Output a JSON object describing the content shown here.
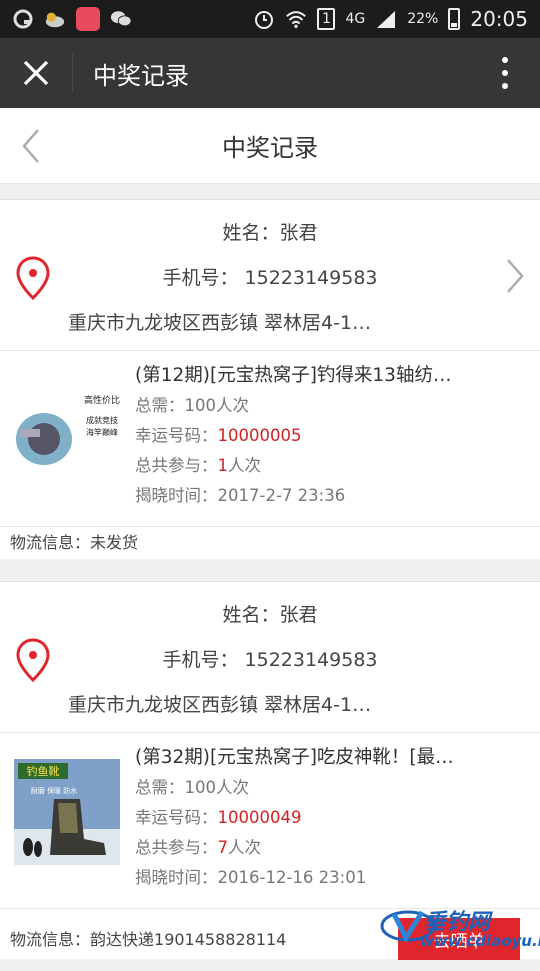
{
  "status_bar": {
    "network": "4G",
    "battery": "22%",
    "time": "20:05",
    "sim": "1"
  },
  "app_bar": {
    "title": "中奖记录"
  },
  "page": {
    "title": "中奖记录"
  },
  "records": [
    {
      "name_label": "姓名：",
      "name": "张君",
      "phone_label": "手机号：",
      "phone": "15223149583",
      "address": "重庆市九龙坡区西彭镇 翠林居4-1…",
      "product_title": "(第12期)[元宝热窝子]钓得来13轴纺…",
      "required_label": "总需：",
      "required": "100人次",
      "lucky_label": "幸运号码：",
      "lucky": "10000005",
      "joined_label": "总共参与：",
      "joined_count": "1",
      "joined_unit": "人次",
      "reveal_label": "揭晓时间：",
      "reveal_time": "2017-2-7 23:36",
      "logistics_label": "物流信息：",
      "logistics": "未发货",
      "thumb_lines": [
        "高性价比",
        "成就竞技",
        "海竿巅峰"
      ]
    },
    {
      "name_label": "姓名：",
      "name": "张君",
      "phone_label": "手机号：",
      "phone": "15223149583",
      "address": "重庆市九龙坡区西彭镇 翠林居4-1…",
      "product_title": "(第32期)[元宝热窝子]吃皮神靴！[最…",
      "required_label": "总需：",
      "required": "100人次",
      "lucky_label": "幸运号码：",
      "lucky": "10000049",
      "joined_label": "总共参与：",
      "joined_count": "7",
      "joined_unit": "人次",
      "reveal_label": "揭晓时间：",
      "reveal_time": "2016-12-16 23:01",
      "logistics_label": "物流信息：",
      "logistics": "韵达快递1901458828114",
      "thumb_lines": [
        "钓鱼靴",
        "耐磨 保暖 防水"
      ]
    }
  ],
  "share_button": "去晒单",
  "watermark": {
    "text": "垂钓网",
    "url": "www.cdiaoyu.net"
  },
  "colors": {
    "accent_red": "#d42222",
    "pin_red": "#e0262c",
    "app_bar": "#363636"
  }
}
